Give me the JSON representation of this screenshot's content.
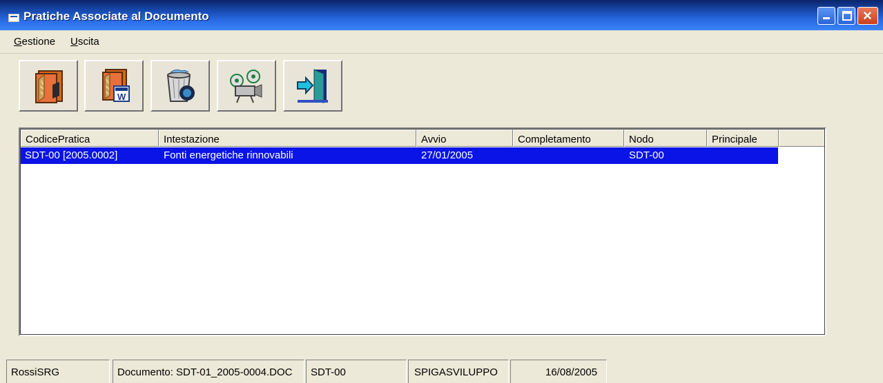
{
  "window": {
    "title": "Pratiche Associate al Documento"
  },
  "menu": {
    "items": [
      {
        "label_acc": "G",
        "label_rest": "estione"
      },
      {
        "label_acc": "U",
        "label_rest": "scita"
      }
    ]
  },
  "toolbar": {
    "buttons": [
      {
        "icon": "open-dossier-icon"
      },
      {
        "icon": "word-dossier-icon"
      },
      {
        "icon": "trash-search-icon"
      },
      {
        "icon": "projector-icon"
      },
      {
        "icon": "exit-door-icon"
      }
    ]
  },
  "grid": {
    "columns": [
      "CodicePratica",
      "Intestazione",
      "Avvio",
      "Completamento",
      "Nodo",
      "Principale"
    ],
    "rows": [
      {
        "codice": "SDT-00 [2005.0002]",
        "intestazione": "Fonti energetiche rinnovabili",
        "avvio": "27/01/2005",
        "completamento": "",
        "nodo": "SDT-00",
        "principale": ""
      }
    ],
    "selection_color": "#0a14e6"
  },
  "status": {
    "user": "RossiSRG",
    "documento": "Documento: SDT-01_2005-0004.DOC",
    "nodo": "SDT-00",
    "server": "SPIGASVILUPPO",
    "data": "16/08/2005"
  }
}
